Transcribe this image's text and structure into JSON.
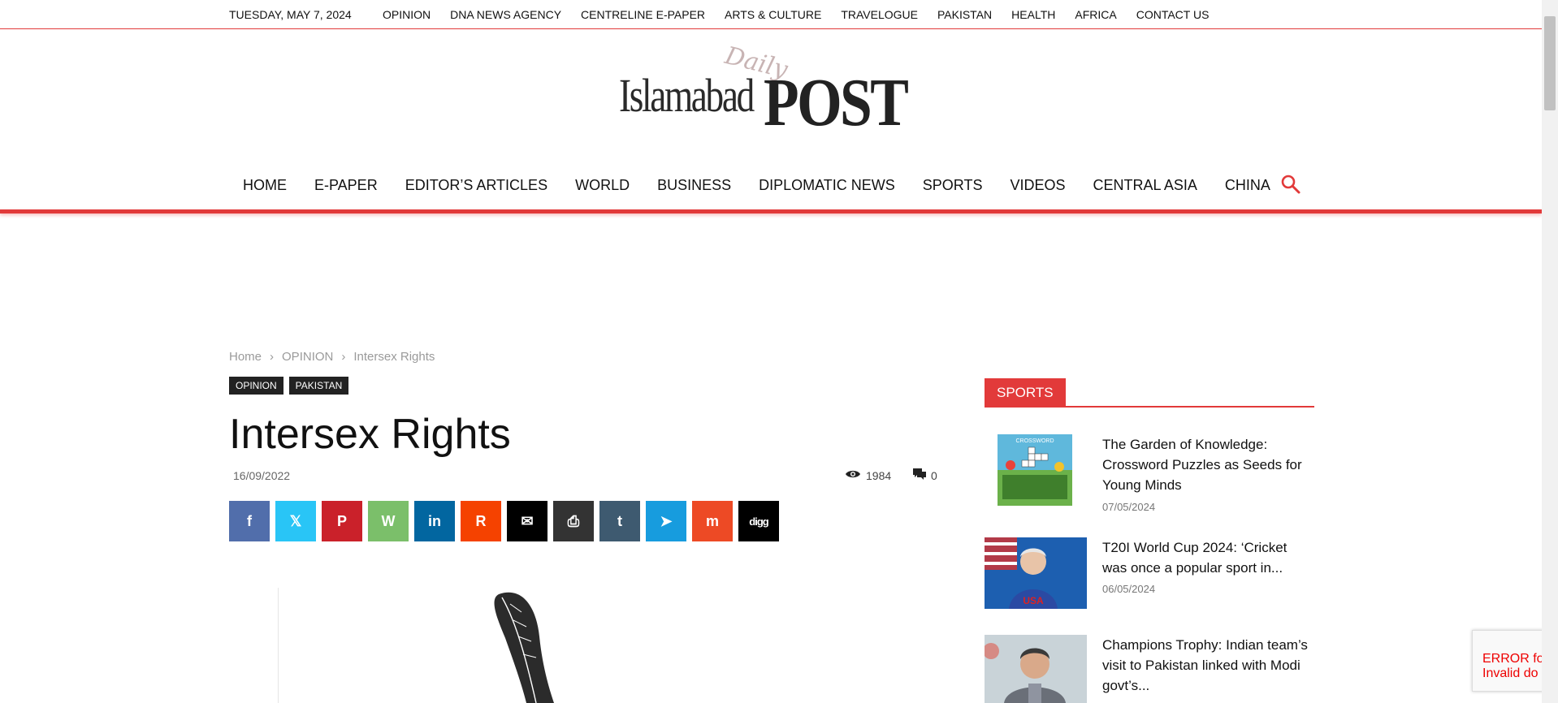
{
  "topbar": {
    "date": "TUESDAY, MAY 7, 2024",
    "links": [
      "OPINION",
      "DNA NEWS AGENCY",
      "CENTRELINE E-PAPER",
      "ARTS & CULTURE",
      "TRAVELOGUE",
      "PAKISTAN",
      "HEALTH",
      "AFRICA",
      "CONTACT US"
    ]
  },
  "logo": {
    "daily": "Daily",
    "islamabad": "Islamabad",
    "post": "POST"
  },
  "nav": {
    "items": [
      "HOME",
      "E-PAPER",
      "EDITOR’S ARTICLES",
      "WORLD",
      "BUSINESS",
      "DIPLOMATIC NEWS",
      "SPORTS",
      "VIDEOS",
      "CENTRAL ASIA",
      "CHINA"
    ],
    "search_icon": "search-icon"
  },
  "breadcrumb": {
    "home": "Home",
    "section": "OPINION",
    "current": "Intersex Rights",
    "sep": "›"
  },
  "article": {
    "tags": [
      "OPINION",
      "PAKISTAN"
    ],
    "title": "Intersex Rights",
    "date": "16/09/2022",
    "views": "1984",
    "comments": "0"
  },
  "share": [
    {
      "name": "facebook",
      "glyph": "f",
      "color": "#516eab"
    },
    {
      "name": "x",
      "glyph": "𝕏",
      "color": "#29c5f6"
    },
    {
      "name": "pinterest",
      "glyph": "P",
      "color": "#ca212a"
    },
    {
      "name": "whatsapp",
      "glyph": "W",
      "color": "#7bbf6a"
    },
    {
      "name": "linkedin",
      "glyph": "in",
      "color": "#0266a0"
    },
    {
      "name": "reddit",
      "glyph": "R",
      "color": "#f54200"
    },
    {
      "name": "email",
      "glyph": "✉",
      "color": "#000000"
    },
    {
      "name": "print",
      "glyph": "⎙",
      "color": "#333333"
    },
    {
      "name": "tumblr",
      "glyph": "t",
      "color": "#3e5a70"
    },
    {
      "name": "telegram",
      "glyph": "➤",
      "color": "#179cde"
    },
    {
      "name": "mix",
      "glyph": "m",
      "color": "#ed4a25"
    },
    {
      "name": "digg",
      "glyph": "digg",
      "color": "#000000"
    }
  ],
  "sidebar": {
    "heading": "SPORTS",
    "items": [
      {
        "title": "The Garden of Knowledge: Crossword Puzzles as Seeds for Young Minds",
        "date": "07/05/2024",
        "thumb_label": "CROSSWORD"
      },
      {
        "title": "T20I World Cup 2024: ‘Cricket was once a popular sport in...",
        "date": "06/05/2024",
        "thumb_label": "USA"
      },
      {
        "title": "Champions Trophy: Indian team’s visit to Pakistan linked with Modi govt’s...",
        "date": "06/05/2024",
        "thumb_label": ""
      }
    ]
  },
  "recaptcha": {
    "line1": "ERROR fo",
    "line2": "Invalid do"
  },
  "colors": {
    "accent": "#e23a3a",
    "tag_bg": "#222222"
  }
}
